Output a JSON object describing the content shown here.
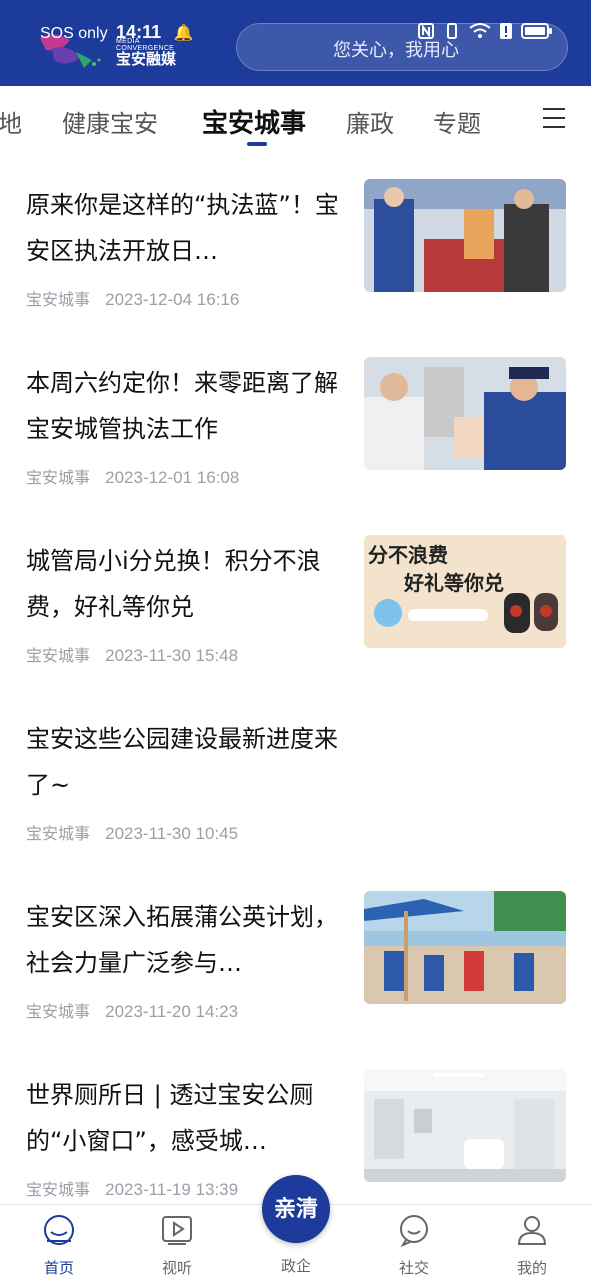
{
  "status_bar": {
    "carrier": "SOS only",
    "time": "14:11"
  },
  "header": {
    "logo_en": "MEDIA CONVERGENCE",
    "logo_cn": "宝安融媒",
    "search_placeholder": "您关心，我用心"
  },
  "tabs": [
    {
      "label": "地"
    },
    {
      "label": "健康宝安"
    },
    {
      "label": "宝安城事"
    },
    {
      "label": "廉政"
    },
    {
      "label": "专题"
    }
  ],
  "articles": [
    {
      "title": "原来你是这样的“执法蓝”！宝安区执法开放日…",
      "source": "宝安城事",
      "date": "2023-12-04 16:16"
    },
    {
      "title": "本周六约定你！来零距离了解宝安城管执法工作",
      "source": "宝安城事",
      "date": "2023-12-01 16:08"
    },
    {
      "title": "城管局小i分兑换！积分不浪费，好礼等你兑",
      "source": "宝安城事",
      "date": "2023-11-30 15:48"
    },
    {
      "title": "宝安这些公园建设最新进度来了~",
      "source": "宝安城事",
      "date": "2023-11-30 10:45"
    },
    {
      "title": "宝安区深入拓展蒲公英计划，社会力量广泛参与…",
      "source": "宝安城事",
      "date": "2023-11-20 14:23"
    },
    {
      "title": "世界厕所日 | 透过宝安公厕的“小窗口”，感受城…",
      "source": "宝安城事",
      "date": "2023-11-19 13:39"
    }
  ],
  "thumb3_text": {
    "line1": "分不浪费",
    "line2": "好礼等你兑"
  },
  "bottom_nav": {
    "home": "首页",
    "video": "视听",
    "center_badge": "亲清",
    "gov": "政企",
    "social": "社交",
    "me": "我的"
  },
  "colors": {
    "brand": "#1d3b9a",
    "meta": "#9aa0a8"
  }
}
